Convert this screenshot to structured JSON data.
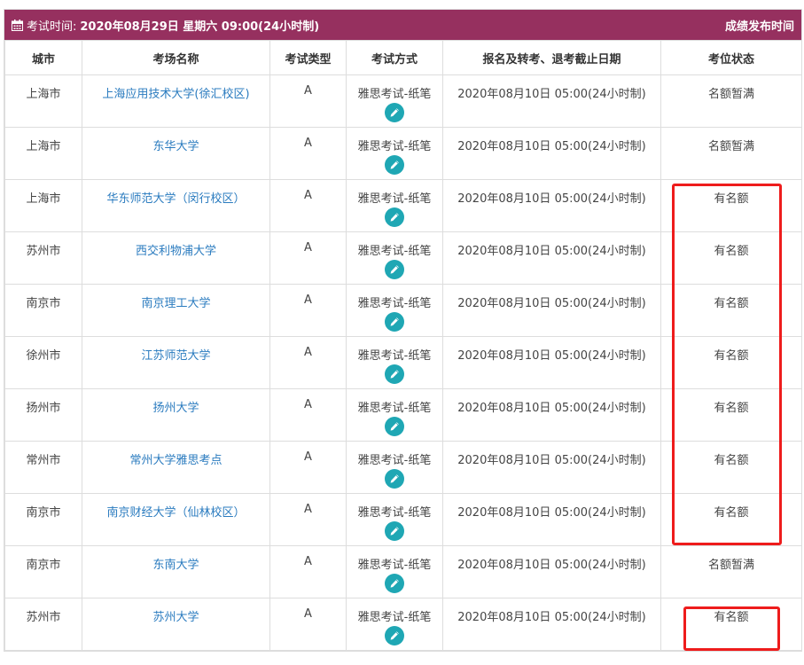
{
  "header": {
    "label": "考试时间:",
    "datetime": "2020年08月29日 星期六 09:00(24小时制)",
    "right_link": "成绩发布时间",
    "icon": "calendar-icon"
  },
  "columns": [
    "城市",
    "考场名称",
    "考试类型",
    "考试方式",
    "报名及转考、退考截止日期",
    "考位状态"
  ],
  "rows": [
    {
      "city": "上海市",
      "venue": "上海应用技术大学(徐汇校区)",
      "type": "A",
      "mode": "雅思考试-纸笔",
      "deadline": "2020年08月10日 05:00(24小时制)",
      "status": "名额暂满"
    },
    {
      "city": "上海市",
      "venue": "东华大学",
      "type": "A",
      "mode": "雅思考试-纸笔",
      "deadline": "2020年08月10日 05:00(24小时制)",
      "status": "名额暂满"
    },
    {
      "city": "上海市",
      "venue": "华东师范大学（闵行校区）",
      "type": "A",
      "mode": "雅思考试-纸笔",
      "deadline": "2020年08月10日 05:00(24小时制)",
      "status": "有名额"
    },
    {
      "city": "苏州市",
      "venue": "西交利物浦大学",
      "type": "A",
      "mode": "雅思考试-纸笔",
      "deadline": "2020年08月10日 05:00(24小时制)",
      "status": "有名额"
    },
    {
      "city": "南京市",
      "venue": "南京理工大学",
      "type": "A",
      "mode": "雅思考试-纸笔",
      "deadline": "2020年08月10日 05:00(24小时制)",
      "status": "有名额"
    },
    {
      "city": "徐州市",
      "venue": "江苏师范大学",
      "type": "A",
      "mode": "雅思考试-纸笔",
      "deadline": "2020年08月10日 05:00(24小时制)",
      "status": "有名额"
    },
    {
      "city": "扬州市",
      "venue": "扬州大学",
      "type": "A",
      "mode": "雅思考试-纸笔",
      "deadline": "2020年08月10日 05:00(24小时制)",
      "status": "有名额"
    },
    {
      "city": "常州市",
      "venue": "常州大学雅思考点",
      "type": "A",
      "mode": "雅思考试-纸笔",
      "deadline": "2020年08月10日 05:00(24小时制)",
      "status": "有名额"
    },
    {
      "city": "南京市",
      "venue": "南京财经大学（仙林校区）",
      "type": "A",
      "mode": "雅思考试-纸笔",
      "deadline": "2020年08月10日 05:00(24小时制)",
      "status": "有名额"
    },
    {
      "city": "南京市",
      "venue": "东南大学",
      "type": "A",
      "mode": "雅思考试-纸笔",
      "deadline": "2020年08月10日 05:00(24小时制)",
      "status": "名额暂满"
    },
    {
      "city": "苏州市",
      "venue": "苏州大学",
      "type": "A",
      "mode": "雅思考试-纸笔",
      "deadline": "2020年08月10日 05:00(24小时制)",
      "status": "有名额"
    }
  ],
  "colors": {
    "header_bg": "#96305f",
    "link": "#2a7bbf",
    "pen_button": "#1fa7b4",
    "annotation": "#ee1c1c"
  }
}
